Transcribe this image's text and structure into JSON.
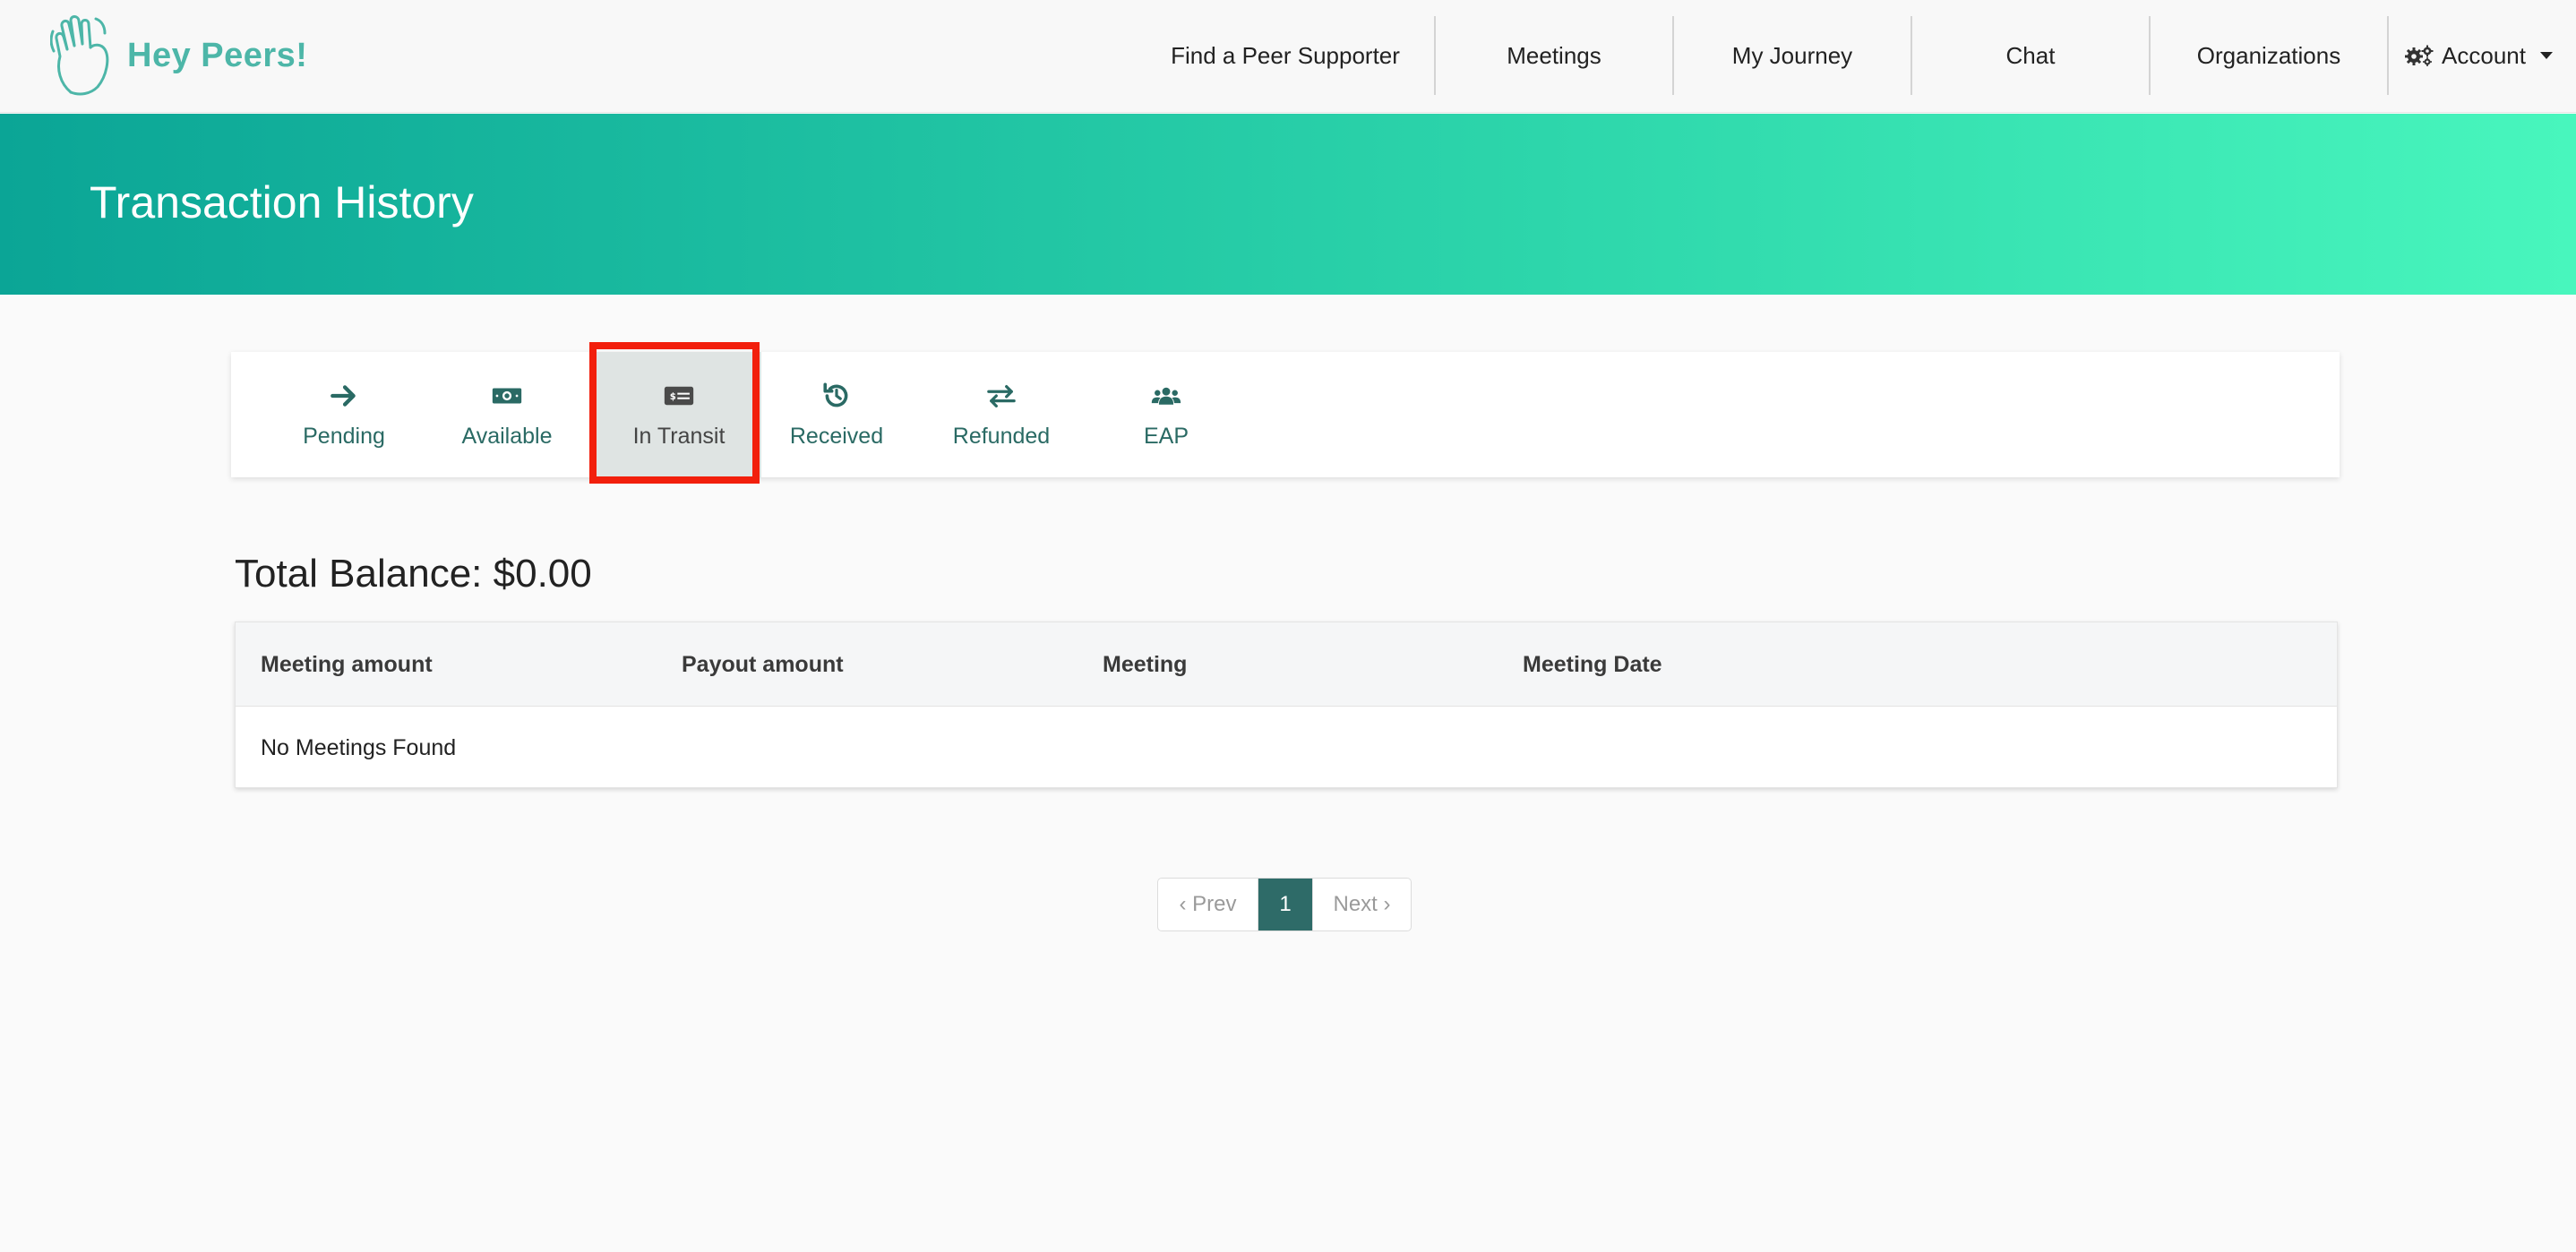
{
  "brand": {
    "name": "Hey Peers!",
    "logo_icon": "waving-hand-icon"
  },
  "nav": {
    "items": [
      {
        "label": "Find a Peer Supporter"
      },
      {
        "label": "Meetings"
      },
      {
        "label": "My Journey"
      },
      {
        "label": "Chat"
      },
      {
        "label": "Organizations"
      }
    ],
    "account": {
      "label": "Account",
      "icon": "gears-icon"
    }
  },
  "hero": {
    "title": "Transaction History"
  },
  "tabs": [
    {
      "label": "Pending",
      "icon": "arrow-right-icon"
    },
    {
      "label": "Available",
      "icon": "money-bill-icon"
    },
    {
      "label": "In Transit",
      "icon": "money-check-icon",
      "active": true
    },
    {
      "label": "Received",
      "icon": "history-icon"
    },
    {
      "label": "Refunded",
      "icon": "exchange-icon"
    },
    {
      "label": "EAP",
      "icon": "users-icon"
    }
  ],
  "balance": {
    "text": "Total Balance: $0.00"
  },
  "table": {
    "columns": [
      "Meeting amount",
      "Payout amount",
      "Meeting",
      "Meeting Date"
    ],
    "empty_text": "No Meetings Found"
  },
  "pagination": {
    "prev": "‹ Prev",
    "current": "1",
    "next": "Next ›"
  },
  "colors": {
    "brand": "#4db6a8",
    "hero_gradient_start": "#0ba596",
    "hero_gradient_end": "#48f6bd",
    "tab_text": "#2a6a64",
    "active_page": "#2e6b68",
    "highlight": "#f21f0c"
  }
}
